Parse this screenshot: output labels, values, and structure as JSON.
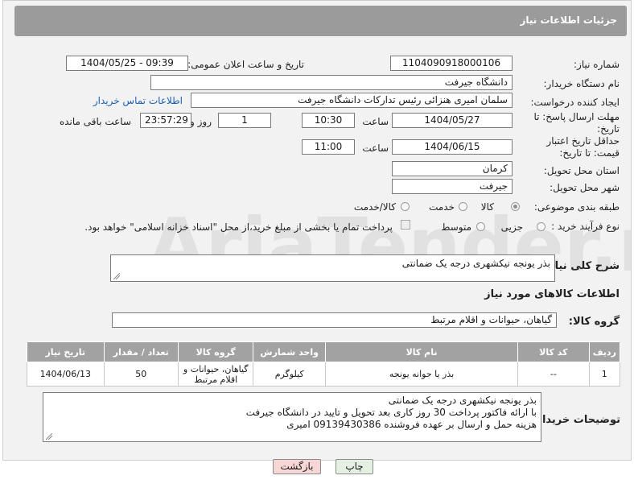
{
  "header": {
    "title": "جزئیات اطلاعات نیاز"
  },
  "labels": {
    "need_number": "شماره نیاز:",
    "announce_datetime": "تاریخ و ساعت اعلان عمومی:",
    "buyer_org": "نام دستگاه خریدار:",
    "creator": "ایجاد کننده درخواست:",
    "deadline": "مهلت ارسال پاسخ: تا تاریخ:",
    "time": "ساعت",
    "day_and": "روز و",
    "remaining": "ساعت باقی مانده",
    "price_validity": "حداقل تاریخ اعتبار قیمت: تا تاریخ:",
    "province": "استان محل تحویل:",
    "city": "شهر محل تحویل:",
    "category": "طبقه بندی موضوعی:",
    "process_type": "نوع فرآیند خرید :",
    "general_desc": "شرح کلی نیاز:",
    "goods_info": "اطلاعات کالاهای مورد نیاز",
    "goods_group": "گروه کالا:",
    "buyer_notes": "توضیحات خریدار:"
  },
  "fields": {
    "need_number": "1104090918000106",
    "announce_datetime": "1404/05/25 - 09:39",
    "buyer_org": "دانشگاه جیرفت",
    "creator": "سلمان امیری هنزائی رئیس تدارکات دانشگاه جیرفت",
    "contact_link": "اطلاعات تماس خریدار",
    "deadline_date": "1404/05/27",
    "deadline_time": "10:30",
    "deadline_days": "1",
    "remaining_time": "23:57:29",
    "price_validity_date": "1404/06/15",
    "price_validity_time": "11:00",
    "province": "کرمان",
    "city": "جیرفت",
    "general_desc": "بذر یونجه نیکشهری درجه یک ضمانتی",
    "goods_group": "گیاهان، حیوانات و اقلام مرتبط"
  },
  "category_options": {
    "goods": "کالا",
    "service": "خدمت",
    "goods_service": "کالا/خدمت"
  },
  "process_options": {
    "minor": "جزیی",
    "medium": "متوسط",
    "treasury_note": "پرداخت تمام یا بخشی از مبلغ خرید،از محل \"اسناد خزانه اسلامی\" خواهد بود."
  },
  "table": {
    "headers": [
      "ردیف",
      "کد کالا",
      "نام کالا",
      "واحد شمارش",
      "گروه کالا",
      "تعداد / مقدار",
      "تاریخ نیاز"
    ],
    "rows": [
      {
        "row": "1",
        "code": "--",
        "name": "بذر یا جوانه یونجه",
        "unit": "کیلوگرم",
        "group": "گیاهان، حیوانات و اقلام مرتبط",
        "qty": "50",
        "date": "1404/06/13"
      }
    ]
  },
  "buyer_notes": [
    "بذر یونجه نیکشهری درجه یک ضمانتی",
    "با ارائه فاکتور پرداخت 30 روز کاری بعد تحویل و تایید در دانشگاه جیرفت",
    "هزینه حمل و ارسال بر عهده فروشنده 09139430386 امیری"
  ],
  "buttons": {
    "print": "چاپ",
    "back": "بازگشت"
  },
  "watermark": {
    "text": "AriaTender.net"
  },
  "colors": {
    "title_bg": "#9b9b9b",
    "panel_bg": "#f2f2f2",
    "link": "#1b5fb4",
    "back_btn_bg": "#f7d6d6",
    "print_btn_bg": "#e4f1e2"
  }
}
